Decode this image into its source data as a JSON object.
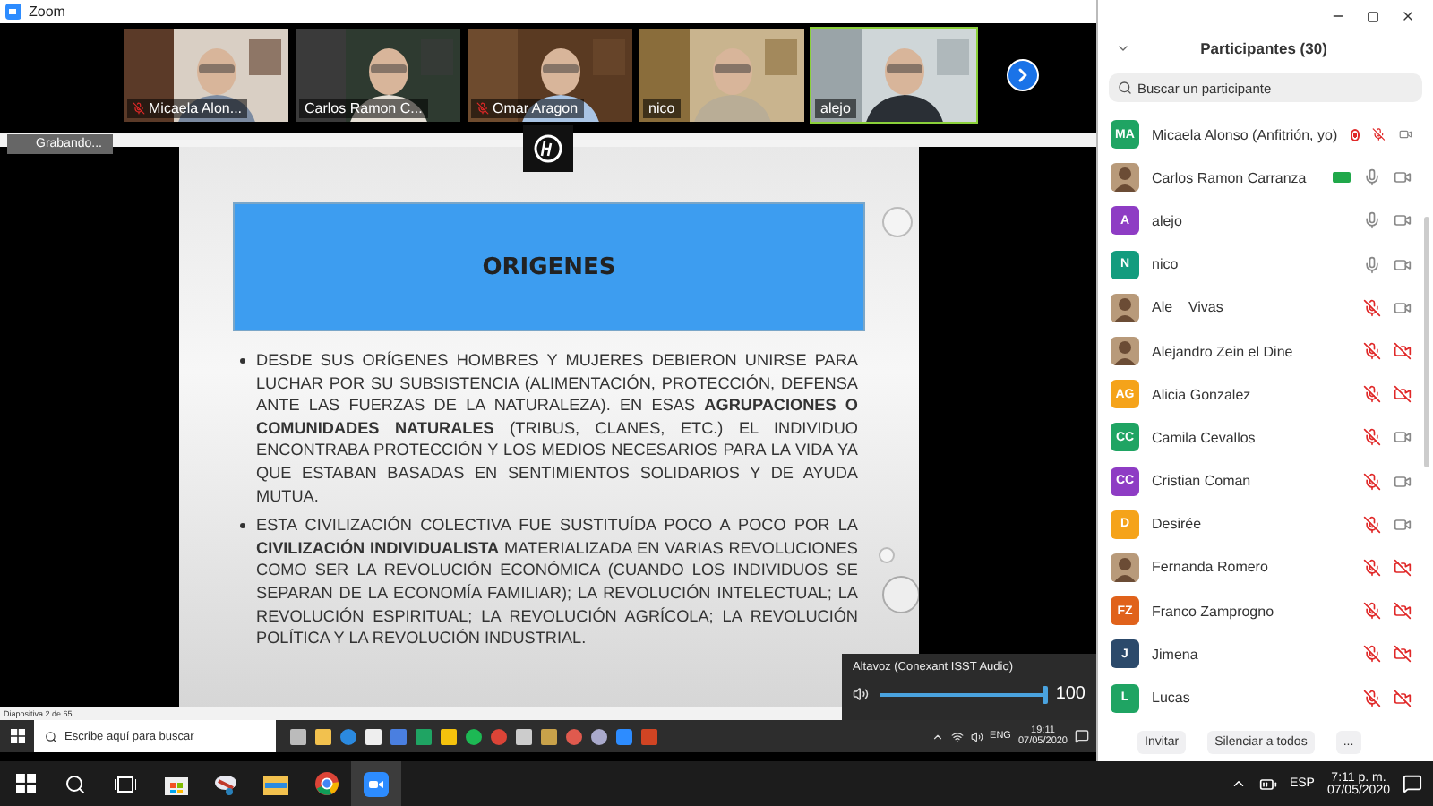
{
  "window": {
    "title": "Zoom"
  },
  "video_strip": {
    "tiles": [
      {
        "name": "Micaela Alon...",
        "muted": true,
        "speaking": false
      },
      {
        "name": "Carlos Ramon C...",
        "muted": false,
        "speaking": false
      },
      {
        "name": "Omar Aragon",
        "muted": true,
        "speaking": false
      },
      {
        "name": "nico",
        "muted": false,
        "speaking": false
      },
      {
        "name": "alejo",
        "muted": false,
        "speaking": true
      }
    ]
  },
  "shared_screen": {
    "recording_label": "Grabando...",
    "slide": {
      "title": "ORIGENES",
      "bullets": [
        "DESDE SUS ORÍGENES HOMBRES Y MUJERES DEBIERON UNIRSE PARA LUCHAR POR SU SUBSISTENCIA (ALIMENTACIÓN, PROTECCIÓN, DEFENSA ANTE LAS FUERZAS DE LA NATURALEZA). EN ESAS **AGRUPACIONES O COMUNIDADES NATURALES** (TRIBUS, CLANES, ETC.)  EL INDIVIDUO ENCONTRABA PROTECCIÓN Y LOS MEDIOS NECESARIOS PARA LA VIDA YA QUE ESTABAN BASADAS EN  SENTIMIENTOS SOLIDARIOS Y DE AYUDA MUTUA.",
        "ESTA CIVILIZACIÓN COLECTIVA FUE SUSTITUÍDA POCO A POCO POR LA **CIVILIZACIÓN INDIVIDUALISTA** MATERIALIZADA EN VARIAS REVOLUCIONES COMO SER LA REVOLUCIÓN ECONÓMICA (CUANDO LOS INDIVIDUOS SE SEPARAN DE LA ECONOMÍA FAMILIAR); LA REVOLUCIÓN INTELECTUAL; LA REVOLUCIÓN ESPIRITUAL; LA REVOLUCIÓN AGRÍCOLA; LA REVOLUCIÓN POLÍTICA Y LA REVOLUCIÓN INDUSTRIAL."
      ]
    },
    "status": "Diapositiva 2 de 65",
    "taskbar": {
      "search_placeholder": "Escribe aquí para buscar",
      "language": "ENG",
      "time": "19:11",
      "date": "07/05/2020"
    },
    "volume": {
      "device": "Altavoz (Conexant ISST Audio)",
      "level": 1,
      "reading": "100"
    }
  },
  "participants_panel": {
    "title": "Participantes (30)",
    "search": {
      "placeholder": "Buscar un participante"
    },
    "participants": [
      {
        "name": "Micaela Alonso (Anfitrión, yo)",
        "kind": "initials",
        "initials": "MA",
        "color": "#1fa463",
        "recording": true,
        "sharing": false,
        "muted": true,
        "camera_off": false
      },
      {
        "name": "Carlos Ramon Carranza",
        "recording": false,
        "sharing": true,
        "muted": false,
        "camera_off": false
      },
      {
        "name": "alejo",
        "kind": "initials",
        "initials": "A",
        "color": "#8e3cc4",
        "recording": false,
        "sharing": false,
        "muted": false,
        "camera_off": false
      },
      {
        "name": "nico",
        "kind": "initials",
        "initials": "N",
        "color": "#139c7e",
        "recording": false,
        "sharing": false,
        "muted": false,
        "camera_off": false
      },
      {
        "name": "Ale    Vivas",
        "recording": false,
        "sharing": false,
        "muted": true,
        "camera_off": false
      },
      {
        "name": "Alejandro Zein el Dine",
        "recording": false,
        "sharing": false,
        "muted": true,
        "camera_off": true
      },
      {
        "name": "Alicia Gonzalez",
        "kind": "initials",
        "initials": "AG",
        "color": "#f5a31a",
        "recording": false,
        "sharing": false,
        "muted": true,
        "camera_off": true
      },
      {
        "name": "Camila Cevallos",
        "kind": "initials",
        "initials": "CC",
        "color": "#1fa463",
        "recording": false,
        "sharing": false,
        "muted": true,
        "camera_off": false
      },
      {
        "name": "Cristian Coman",
        "kind": "initials",
        "initials": "CC",
        "color": "#8e3cc4",
        "recording": false,
        "sharing": false,
        "muted": true,
        "camera_off": false
      },
      {
        "name": "Desirée",
        "kind": "initials",
        "initials": "D",
        "color": "#f5a31a",
        "recording": false,
        "sharing": false,
        "muted": true,
        "camera_off": false
      },
      {
        "name": "Fernanda Romero",
        "recording": false,
        "sharing": false,
        "muted": true,
        "camera_off": true
      },
      {
        "name": "Franco Zamprogno",
        "kind": "initials",
        "initials": "FZ",
        "color": "#e0621b",
        "recording": false,
        "sharing": false,
        "muted": true,
        "camera_off": true
      },
      {
        "name": "Jimena",
        "kind": "initials",
        "initials": "J",
        "color": "#2c4a6b",
        "recording": false,
        "sharing": false,
        "muted": true,
        "camera_off": true
      },
      {
        "name": "Lucas",
        "kind": "initials",
        "initials": "L",
        "color": "#1fa463",
        "recording": false,
        "sharing": false,
        "muted": true,
        "camera_off": true
      }
    ],
    "buttons": [
      "Invitar",
      "Silenciar a todos",
      "..."
    ]
  },
  "taskbar": {
    "language": "ESP",
    "time": "7:11 p. m.",
    "date": "07/05/2020"
  }
}
